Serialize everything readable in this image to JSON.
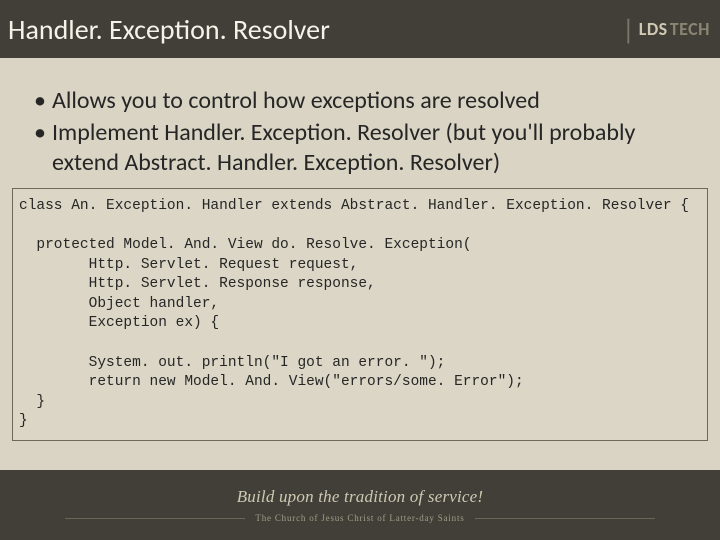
{
  "header": {
    "title": "Handler. Exception. Resolver",
    "logo": {
      "bar": "|",
      "lds": "LDS",
      "tech": "TECH"
    }
  },
  "bullets": [
    "Allows you to control how exceptions are resolved",
    "Implement Handler. Exception. Resolver (but you'll probably extend Abstract. Handler. Exception. Resolver)"
  ],
  "code": "class An. Exception. Handler extends Abstract. Handler. Exception. Resolver {\n\n  protected Model. And. View do. Resolve. Exception(\n        Http. Servlet. Request request,\n        Http. Servlet. Response response,\n        Object handler,\n        Exception ex) {\n\n        System. out. println(\"I got an error. \");\n        return new Model. And. View(\"errors/some. Error\");\n  }\n}",
  "footer": {
    "motto": "Build upon the tradition of service!",
    "church": "The Church of Jesus Christ of Latter-day Saints"
  }
}
